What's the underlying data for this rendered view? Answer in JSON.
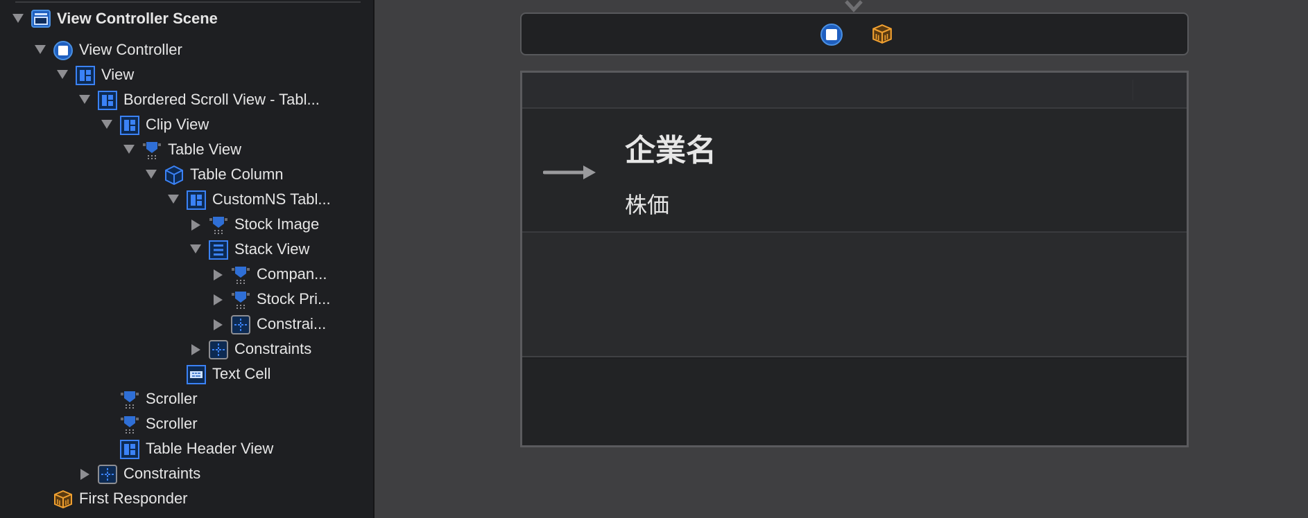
{
  "outline": {
    "items": [
      {
        "label": "View Controller Scene"
      },
      {
        "label": "View Controller"
      },
      {
        "label": "View"
      },
      {
        "label": "Bordered Scroll View - Tabl..."
      },
      {
        "label": "Clip View"
      },
      {
        "label": "Table View"
      },
      {
        "label": "Table Column"
      },
      {
        "label": "CustomNS Tabl..."
      },
      {
        "label": "Stock Image"
      },
      {
        "label": "Stack View"
      },
      {
        "label": "Compan..."
      },
      {
        "label": "Stock Pri..."
      },
      {
        "label": "Constrai..."
      },
      {
        "label": "Constraints"
      },
      {
        "label": "Text Cell"
      },
      {
        "label": "Scroller"
      },
      {
        "label": "Scroller"
      },
      {
        "label": "Table Header View"
      },
      {
        "label": "Constraints"
      },
      {
        "label": "First Responder"
      }
    ]
  },
  "canvas": {
    "cell": {
      "company_name": "企業名",
      "stock_price": "株価"
    }
  },
  "colors": {
    "accent": "#3b82f6",
    "responder": "#f0a030",
    "sidebar_bg": "#1e1f22",
    "canvas_bg": "#3f3f41"
  }
}
